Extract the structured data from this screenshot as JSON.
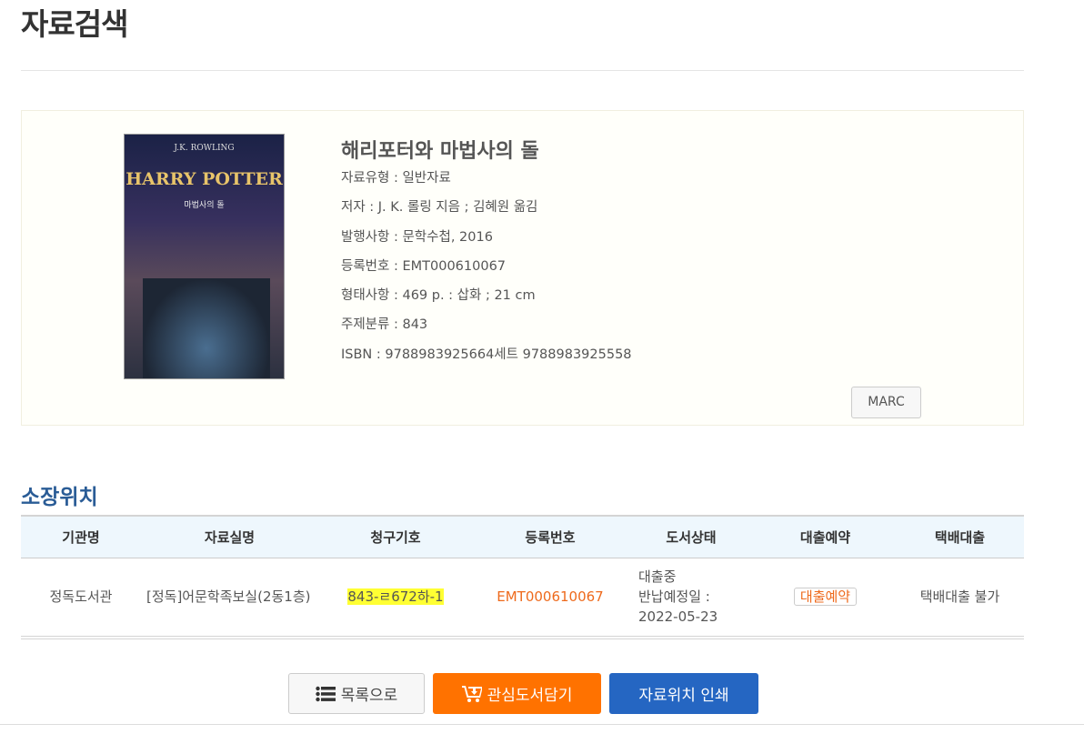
{
  "page": {
    "title": "자료검색"
  },
  "book": {
    "cover_text": {
      "author": "J.K. ROWLING",
      "series": "HARRY POTTER",
      "subtitle": "마법사의 돌"
    },
    "title": "해리포터와 마법사의 돌",
    "fields": [
      "자료유형 : 일반자료",
      "저자 : J. K. 롤링 지음 ; 김혜원 옮김",
      "발행사항 : 문학수첩, 2016",
      "등록번호 : EMT000610067",
      "형태사항 : 469 p. : 삽화 ; 21 cm",
      "주제분류 : 843",
      "ISBN : 9788983925664세트 9788983925558"
    ],
    "marc_label": "MARC"
  },
  "holdings": {
    "heading": "소장위치",
    "columns": [
      "기관명",
      "자료실명",
      "청구기호",
      "등록번호",
      "도서상태",
      "대출예약",
      "택배대출"
    ],
    "rows": [
      {
        "library": "정독도서관",
        "room": "[정독]어문학족보실(2동1층)",
        "call_number": "843-ㄹ672하-1",
        "reg_no": "EMT000610067",
        "status": "대출중",
        "due_label": "반납예정일 :",
        "due_date": "2022-05-23",
        "reserve": "대출예약",
        "delivery": "택배대출 불가"
      }
    ]
  },
  "buttons": {
    "list": "목록으로",
    "wishlist": "관심도서담기",
    "print": "자료위치 인쇄"
  },
  "colors": {
    "accent_orange": "#ff7200",
    "accent_blue": "#2566c2",
    "heading_blue": "#2a5c96",
    "highlight": "#ffff33"
  }
}
